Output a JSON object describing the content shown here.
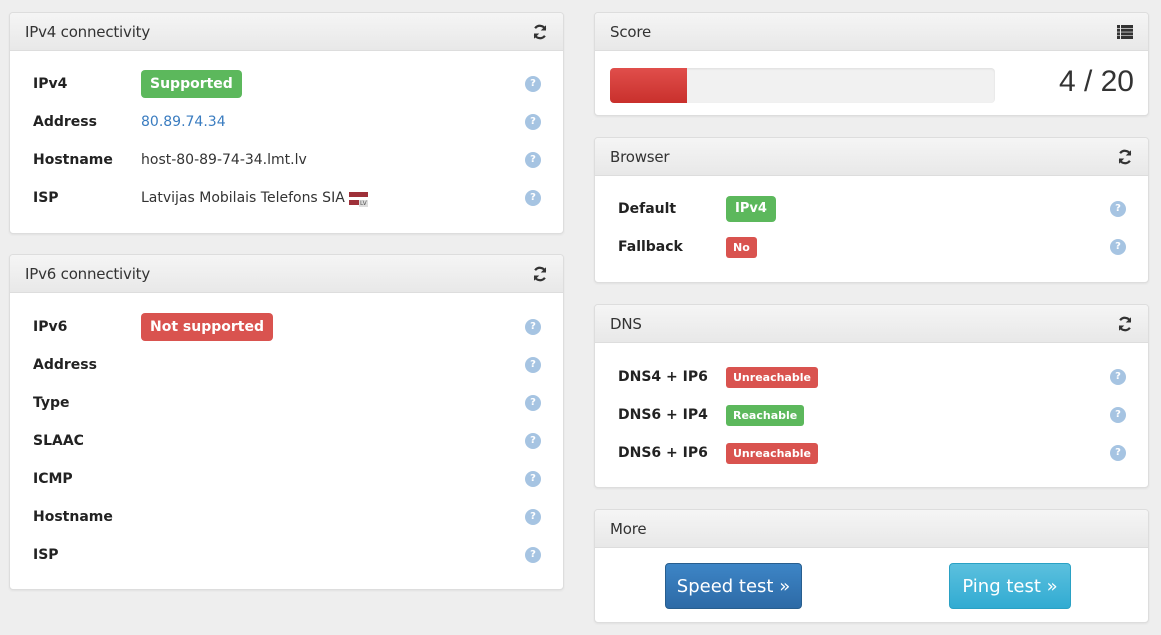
{
  "ipv4_panel": {
    "title": "IPv4 connectivity",
    "header_icon": "refresh-icon",
    "rows": [
      {
        "label": "IPv4",
        "value": "Supported",
        "type": "badge",
        "status": "success"
      },
      {
        "label": "Address",
        "value": "80.89.74.34",
        "type": "link"
      },
      {
        "label": "Hostname",
        "value": "host-80-89-74-34.lmt.lv",
        "type": "text"
      },
      {
        "label": "ISP",
        "value": "Latvijas Mobilais Telefons SIA",
        "type": "text",
        "flag": "LV"
      }
    ]
  },
  "ipv6_panel": {
    "title": "IPv6 connectivity",
    "header_icon": "refresh-icon",
    "rows": [
      {
        "label": "IPv6",
        "value": "Not supported",
        "type": "badge",
        "status": "danger"
      },
      {
        "label": "Address",
        "value": ""
      },
      {
        "label": "Type",
        "value": ""
      },
      {
        "label": "SLAAC",
        "value": ""
      },
      {
        "label": "ICMP",
        "value": ""
      },
      {
        "label": "Hostname",
        "value": ""
      },
      {
        "label": "ISP",
        "value": ""
      }
    ]
  },
  "score_panel": {
    "title": "Score",
    "header_icon": "list-icon",
    "score": 4,
    "max": 20,
    "score_text": "4 / 20",
    "progress_fraction": 0.2
  },
  "browser_panel": {
    "title": "Browser",
    "header_icon": "refresh-icon",
    "rows": [
      {
        "label": "Default",
        "value": "IPv4",
        "status": "success"
      },
      {
        "label": "Fallback",
        "value": "No",
        "status": "danger"
      }
    ]
  },
  "dns_panel": {
    "title": "DNS",
    "header_icon": "refresh-icon",
    "rows": [
      {
        "label": "DNS4 + IP6",
        "value": "Unreachable",
        "status": "danger"
      },
      {
        "label": "DNS6 + IP4",
        "value": "Reachable",
        "status": "success"
      },
      {
        "label": "DNS6 + IP6",
        "value": "Unreachable",
        "status": "danger"
      }
    ]
  },
  "more_panel": {
    "title": "More",
    "speed_test_label": "Speed test »",
    "ping_test_label": "Ping test »"
  },
  "help_glyph": "?",
  "colors": {
    "success": "#5cb85c",
    "danger": "#d9534f",
    "link": "#3a7cc0",
    "primary": "#3071a9",
    "info": "#5bc0de"
  }
}
